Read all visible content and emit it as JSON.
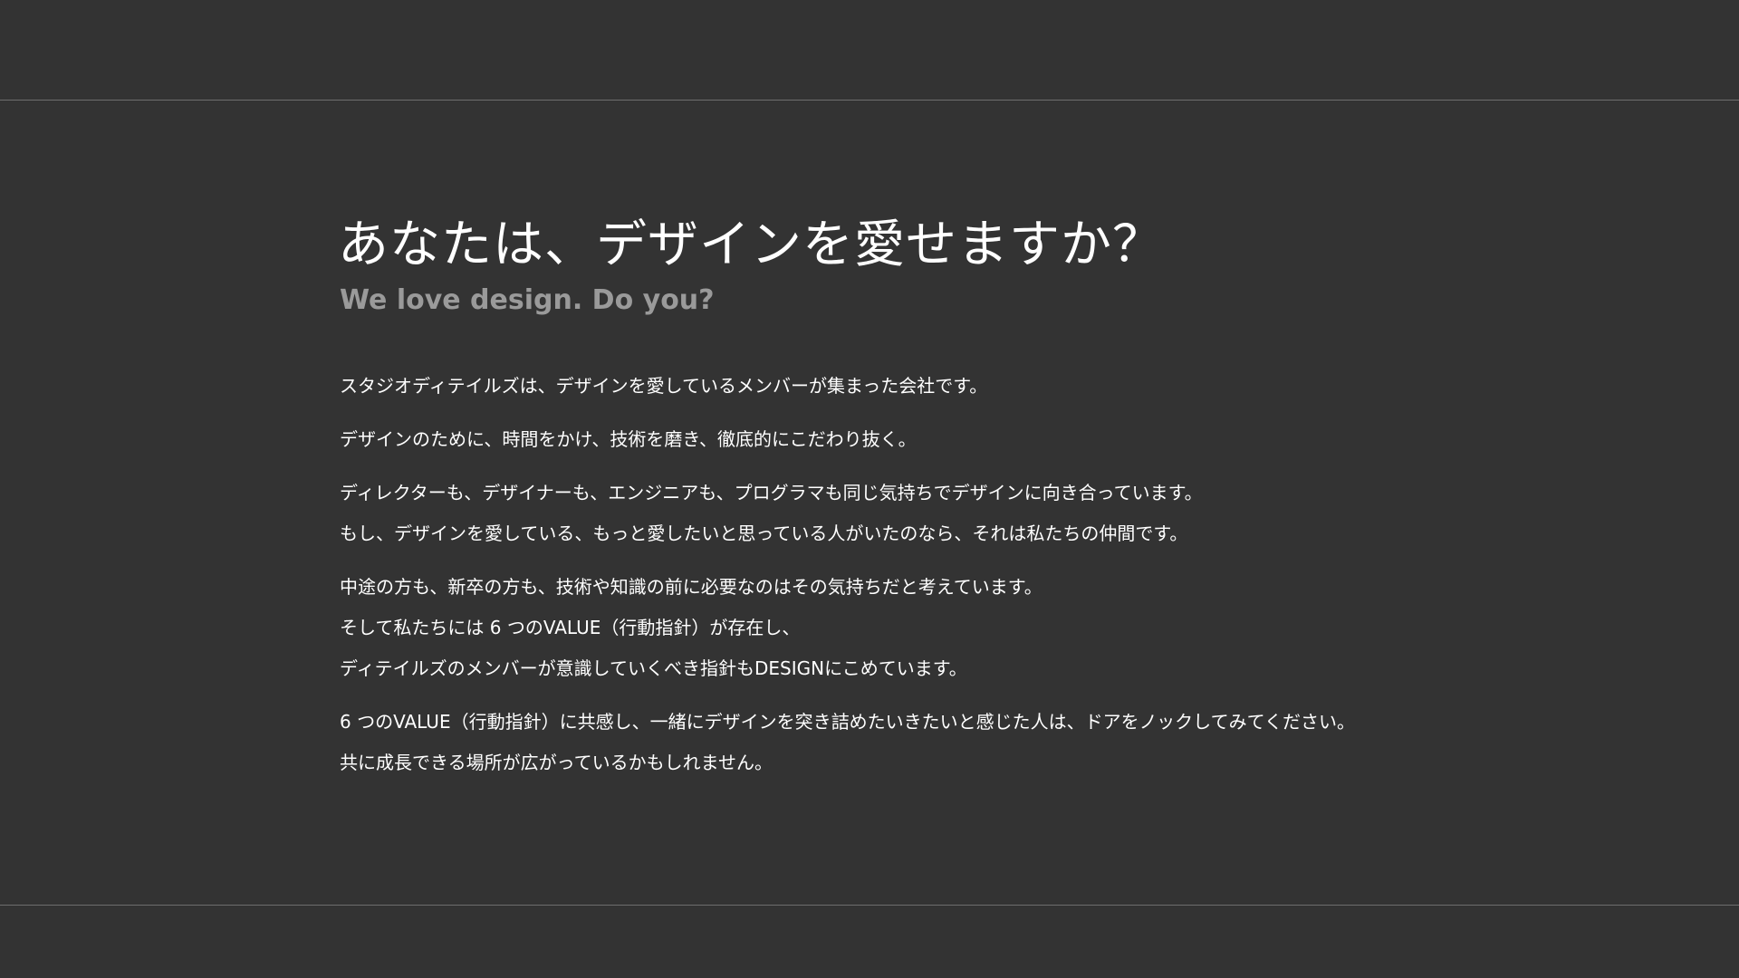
{
  "heading": "あなたは、デザインを愛せますか？",
  "subheading": "We love design. Do you?",
  "paragraphs": [
    {
      "lines": [
        "スタジオディテイルズは、デザインを愛しているメンバーが集まった会社です。"
      ]
    },
    {
      "lines": [
        "デザインのために、時間をかけ、技術を磨き、徹底的にこだわり抜く。"
      ]
    },
    {
      "lines": [
        "ディレクターも、デザイナーも、エンジニアも、プログラマも同じ気持ちでデザインに向き合っています。",
        "もし、デザインを愛している、もっと愛したいと思っている人がいたのなら、それは私たちの仲間です。"
      ]
    },
    {
      "lines": [
        "中途の方も、新卒の方も、技術や知識の前に必要なのはその気持ちだと考えています。",
        "そして私たちには 6 つのVALUE（行動指針）が存在し、",
        "ディテイルズのメンバーが意識していくべき指針もDESIGNにこめています。"
      ]
    },
    {
      "lines": [
        "6 つのVALUE（行動指針）に共感し、一緒にデザインを突き詰めたいきたいと感じた人は、ドアをノックしてみてください。",
        "共に成長できる場所が広がっているかもしれません。"
      ]
    }
  ],
  "colors": {
    "background": "#333333",
    "text": "#ffffff",
    "subheading": "#9a9a9a",
    "rule": "#6e6e6e"
  }
}
